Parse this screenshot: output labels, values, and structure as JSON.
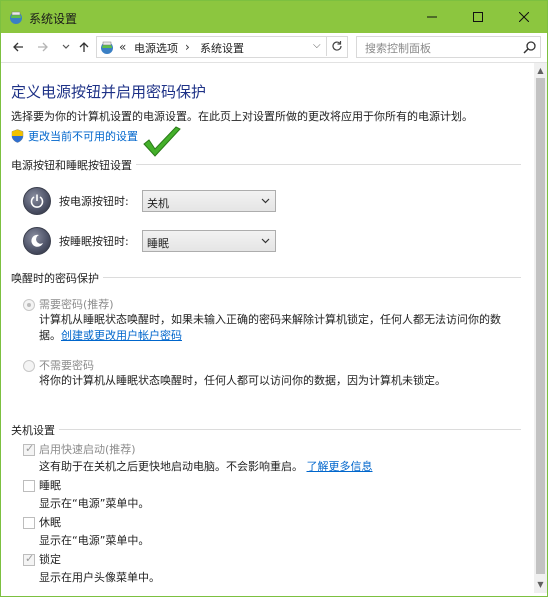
{
  "window": {
    "title": "系统设置",
    "icon": "control-panel-icon",
    "accent": "#8cc63f"
  },
  "nav": {
    "breadcrumb_prefix": "«",
    "breadcrumbs": [
      "电源选项",
      "系统设置"
    ],
    "crumb_sep": "›",
    "search_placeholder": "搜索控制面板"
  },
  "page": {
    "heading": "定义电源按钮并启用密码保护",
    "description": "选择要为你的计算机设置的电源设置。在此页上对设置所做的更改将应用于你所有的电源计划。",
    "change_link": "更改当前不可用的设置"
  },
  "power_buttons": {
    "group_title": "电源按钮和睡眠按钮设置",
    "rows": [
      {
        "label": "按电源按钮时:",
        "value": "关机"
      },
      {
        "label": "按睡眠按钮时:",
        "value": "睡眠"
      }
    ]
  },
  "wake_password": {
    "group_title": "唤醒时的密码保护",
    "options": [
      {
        "label": "需要密码(推荐)",
        "checked": true,
        "desc_line1": "计算机从睡眠状态唤醒时，如果未输入正确的密码来解除计算机锁定，任何人都无法访问你的数",
        "desc_line2": "据。",
        "link": "创建或更改用户帐户密码"
      },
      {
        "label": "不需要密码",
        "checked": false,
        "desc_line1": "将你的计算机从睡眠状态唤醒时，任何人都可以访问你的数据，因为计算机未锁定。"
      }
    ]
  },
  "shutdown": {
    "group_title": "关机设置",
    "items": [
      {
        "label": "启用快速启动(推荐)",
        "checked": true,
        "desc": "这有助于在关机之后更快地启动电脑。不会影响重启。",
        "link": "了解更多信息"
      },
      {
        "label": "睡眠",
        "checked": false,
        "desc": "显示在“电源”菜单中。"
      },
      {
        "label": "休眠",
        "checked": false,
        "desc": "显示在“电源”菜单中。"
      },
      {
        "label": "锁定",
        "checked": true,
        "desc": "显示在用户头像菜单中。"
      }
    ]
  }
}
